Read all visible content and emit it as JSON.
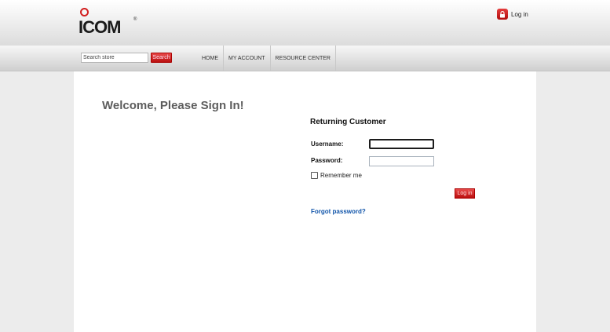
{
  "brand": {
    "logo_text": "ICOM",
    "logo_mark": "®",
    "accent_color": "#cc1a1a"
  },
  "header": {
    "login_link": "Log in",
    "login_icon": "lock-icon"
  },
  "search": {
    "placeholder": "Search store",
    "button_label": "Search"
  },
  "nav": {
    "items": [
      "HOME",
      "MY ACCOUNT",
      "RESOURCE CENTER"
    ]
  },
  "page": {
    "title": "Welcome, Please Sign In!"
  },
  "login_form": {
    "heading": "Returning Customer",
    "username_label": "Username:",
    "username_value": "",
    "password_label": "Password:",
    "password_value": "",
    "remember_label": "Remember me",
    "remember_checked": false,
    "submit_label": "Log in",
    "forgot_link": "Forgot password?"
  }
}
